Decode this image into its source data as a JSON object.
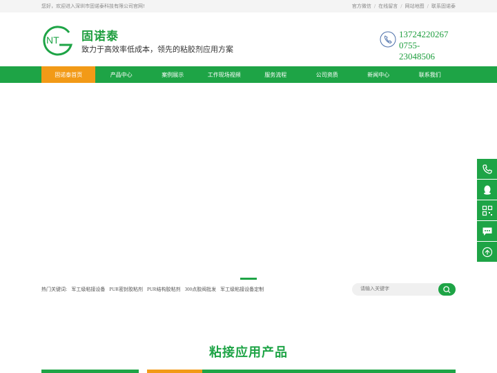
{
  "topbar": {
    "welcome": "您好，欢迎进入深圳市固诺泰科技有限公司官网!",
    "links": [
      "官方微信",
      "在线留言",
      "网站地图",
      "联系固诺泰"
    ],
    "sep": "/"
  },
  "header": {
    "logo_text": "NT",
    "brand_name": "固诺泰",
    "slogan": "致力于高效率低成本，领先的粘胶剂应用方案",
    "phone1": "13724220267",
    "phone2": "0755-23048506"
  },
  "nav": [
    "固诺泰首页",
    "产品中心",
    "案例展示",
    "工作现场视频",
    "服务流程",
    "公司资质",
    "新闻中心",
    "联系我们"
  ],
  "hot": {
    "label": "热门关键词:",
    "keywords": [
      "军工级粘接设备",
      "PUR密封胶粘剂",
      "PUR结构胶粘剂",
      "300点胶阀批发",
      "军工级粘接设备定制"
    ]
  },
  "search": {
    "placeholder": "请输入关键字"
  },
  "section": {
    "title": "粘接应用产品"
  },
  "colors": {
    "green": "#1ea446",
    "orange": "#f29a17"
  }
}
